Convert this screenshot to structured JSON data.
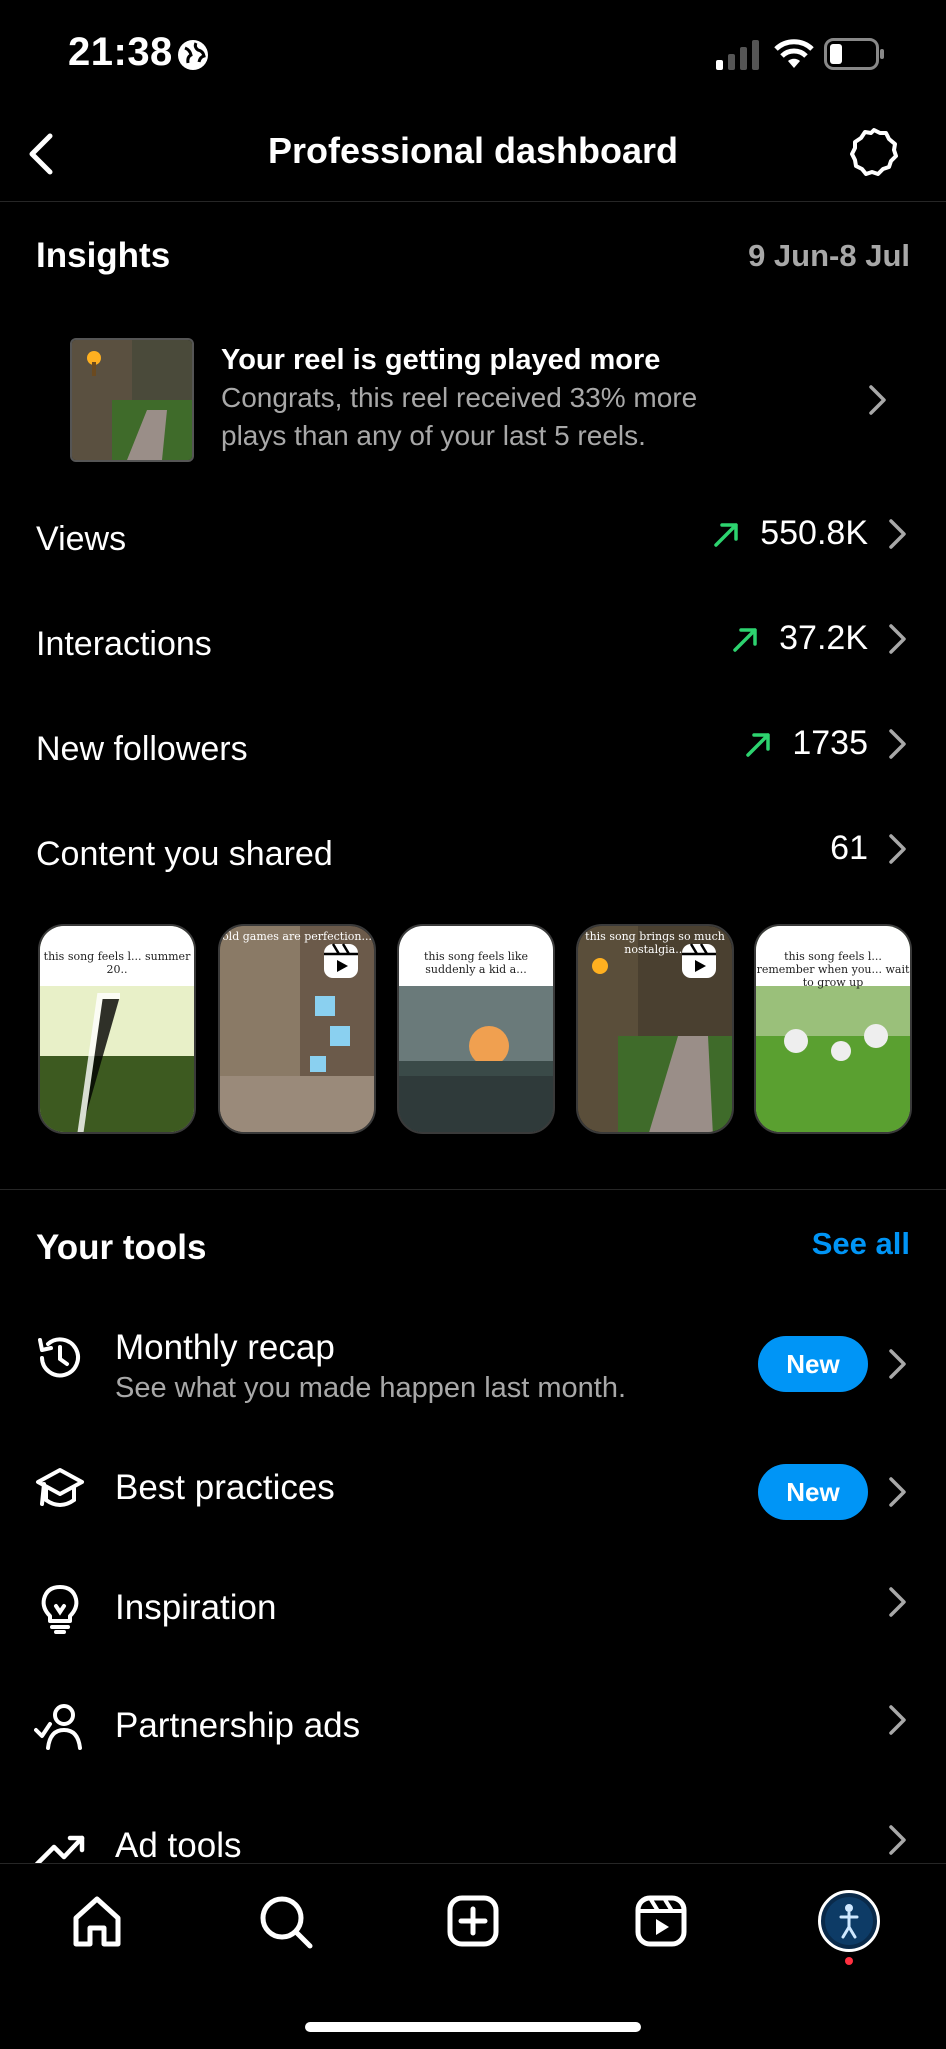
{
  "status": {
    "time": "21:38"
  },
  "header": {
    "title": "Professional dashboard"
  },
  "insights": {
    "title": "Insights",
    "date_range": "9 Jun-8 Jul",
    "highlight": {
      "title": "Your reel is getting played more",
      "body_line1": "Congrats, this reel received 33% more",
      "body_line2": "plays than any of your last 5 reels."
    },
    "metrics": [
      {
        "label": "Views",
        "value": "550.8K",
        "trend": "up"
      },
      {
        "label": "Interactions",
        "value": "37.2K",
        "trend": "up"
      },
      {
        "label": "New followers",
        "value": "1735",
        "trend": "up"
      },
      {
        "label": "Content you shared",
        "value": "61"
      }
    ],
    "reels": [
      {
        "caption": "this song feels l... summer 20..",
        "scene": "sunbeam-field"
      },
      {
        "caption": "old games are perfection...",
        "scene": "minecraft-ore"
      },
      {
        "caption": "this song feels like suddenly a kid a...",
        "scene": "sunset-flowers"
      },
      {
        "caption": "this song brings so much nostalgia...",
        "scene": "minecraft-path"
      },
      {
        "caption": "this song feels l... remember when you... wait to grow up",
        "scene": "dandelions"
      }
    ]
  },
  "tools": {
    "title": "Your tools",
    "see_all": "See all",
    "items": [
      {
        "label": "Monthly recap",
        "sub": "See what you made happen last month.",
        "badge": "New",
        "icon": "history-icon"
      },
      {
        "label": "Best practices",
        "badge": "New",
        "icon": "graduation-cap-icon"
      },
      {
        "label": "Inspiration",
        "icon": "lightbulb-icon"
      },
      {
        "label": "Partnership ads",
        "icon": "partnership-icon"
      },
      {
        "label": "Ad tools",
        "icon": "trend-icon"
      }
    ]
  },
  "colors": {
    "accent": "#0095f6",
    "trend_up": "#2dd36f",
    "muted": "#a8a8a8"
  }
}
